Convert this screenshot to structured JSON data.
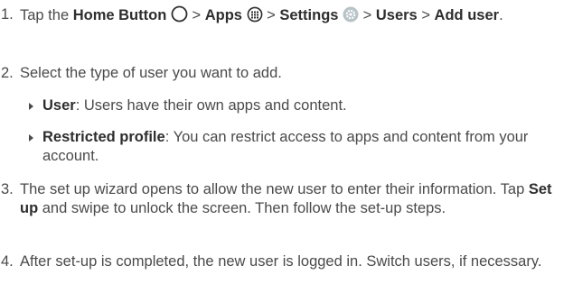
{
  "steps": [
    {
      "num": "1.",
      "tap": "Tap the ",
      "home_button": "Home Button",
      "sep1": " > ",
      "apps": "Apps",
      "sep2": " > ",
      "settings": "Settings",
      "sep3": " > ",
      "users": "Users",
      "sep4": " > ",
      "add_user": "Add user",
      "end": "."
    },
    {
      "num": "2.",
      "text": "Select the type of user you want to add.",
      "options": [
        {
          "label": "User",
          "desc": ": Users have their own apps and content."
        },
        {
          "label": "Restricted profile",
          "desc": ": You can restrict access to apps and content from your account."
        }
      ]
    },
    {
      "num": "3.",
      "pre": "The set up wizard opens to allow the new user to enter their information. Tap ",
      "setup": "Set up",
      "post": " and swipe to unlock the screen. Then follow the set-up steps."
    },
    {
      "num": "4.",
      "text": "After set-up is completed, the new user is logged in. Switch users, if necessary."
    }
  ],
  "icons": {
    "home": "circle-outline-icon",
    "apps": "apps-grid-icon",
    "settings": "gear-icon"
  }
}
